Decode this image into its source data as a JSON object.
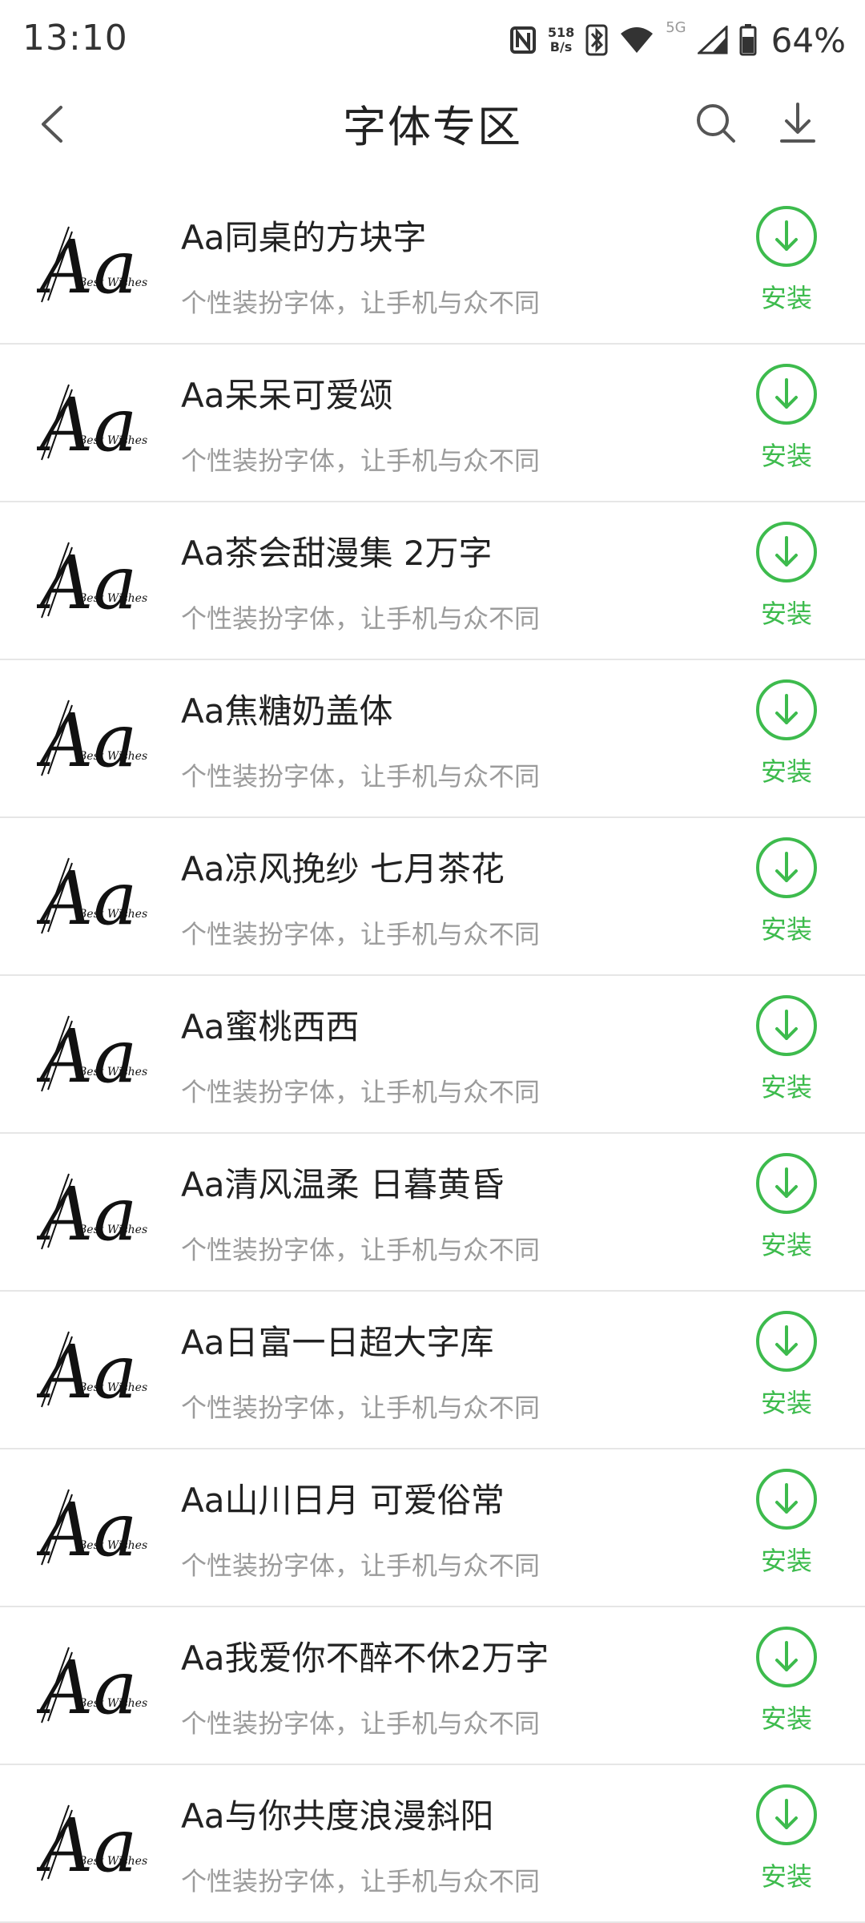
{
  "status_bar": {
    "time": "13:10",
    "net_speed_value": "518",
    "net_speed_unit": "B/s",
    "network_label": "5G",
    "battery": "64%",
    "icons": [
      "nfc-icon",
      "bluetooth-icon",
      "wifi-icon",
      "signal-icon",
      "battery-icon"
    ]
  },
  "header": {
    "title": "字体专区",
    "back_icon": "chevron-left-icon",
    "search_icon": "search-icon",
    "download_icon": "download-icon"
  },
  "accent_color": "#3dbb4d",
  "thumb_text": {
    "big": "Aa",
    "small": "Best Wishes"
  },
  "fonts": [
    {
      "name": "Aa同桌的方块字",
      "desc": "个性装扮字体，让手机与众不同",
      "action": "安装"
    },
    {
      "name": "Aa呆呆可爱颂",
      "desc": "个性装扮字体，让手机与众不同",
      "action": "安装"
    },
    {
      "name": "Aa茶会甜漫集 2万字",
      "desc": "个性装扮字体，让手机与众不同",
      "action": "安装"
    },
    {
      "name": "Aa焦糖奶盖体",
      "desc": "个性装扮字体，让手机与众不同",
      "action": "安装"
    },
    {
      "name": "Aa凉风挽纱 七月茶花",
      "desc": "个性装扮字体，让手机与众不同",
      "action": "安装"
    },
    {
      "name": "Aa蜜桃西西",
      "desc": "个性装扮字体，让手机与众不同",
      "action": "安装"
    },
    {
      "name": "Aa清风温柔 日暮黄昏",
      "desc": "个性装扮字体，让手机与众不同",
      "action": "安装"
    },
    {
      "name": "Aa日富一日超大字库",
      "desc": "个性装扮字体，让手机与众不同",
      "action": "安装"
    },
    {
      "name": "Aa山川日月 可爱俗常",
      "desc": "个性装扮字体，让手机与众不同",
      "action": "安装"
    },
    {
      "name": "Aa我爱你不醉不休2万字",
      "desc": "个性装扮字体，让手机与众不同",
      "action": "安装"
    },
    {
      "name": "Aa与你共度浪漫斜阳",
      "desc": "个性装扮字体，让手机与众不同",
      "action": "安装"
    }
  ]
}
